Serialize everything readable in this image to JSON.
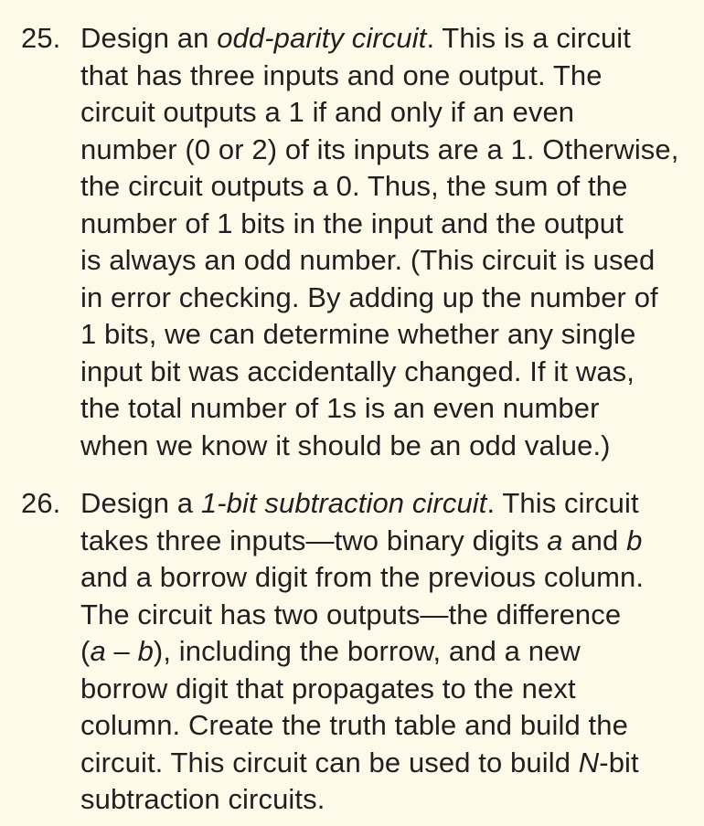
{
  "problems": [
    {
      "number": "25.",
      "lines": [
        [
          {
            "t": "Design an "
          },
          {
            "t": "odd-parity circuit",
            "i": true
          },
          {
            "t": ". This is a circuit"
          }
        ],
        [
          {
            "t": "that has three inputs and one output. The"
          }
        ],
        [
          {
            "t": "circuit outputs a 1 if and only if an even"
          }
        ],
        [
          {
            "t": "number (0 or 2) of its inputs are a 1. Otherwise,"
          }
        ],
        [
          {
            "t": "the circuit outputs a 0. Thus, the sum of the"
          }
        ],
        [
          {
            "t": "number of 1 bits in the input and the output"
          }
        ],
        [
          {
            "t": "is always an odd number. (This circuit is used"
          }
        ],
        [
          {
            "t": "in error checking. By adding up the number of"
          }
        ],
        [
          {
            "t": "1 bits, we can determine whether any single"
          }
        ],
        [
          {
            "t": "input bit was accidentally changed. If it was,"
          }
        ],
        [
          {
            "t": "the total number of 1s is an even number"
          }
        ],
        [
          {
            "t": "when we know it should be an odd value.)"
          }
        ]
      ]
    },
    {
      "number": "26.",
      "lines": [
        [
          {
            "t": "Design a "
          },
          {
            "t": "1-bit subtraction circuit",
            "i": true
          },
          {
            "t": ". This circuit"
          }
        ],
        [
          {
            "t": "takes three inputs—two binary digits "
          },
          {
            "t": "a",
            "i": true
          },
          {
            "t": " and "
          },
          {
            "t": "b",
            "i": true
          }
        ],
        [
          {
            "t": "and a borrow digit from the previous column."
          }
        ],
        [
          {
            "t": "The circuit has two outputs—the difference"
          }
        ],
        [
          {
            "t": "("
          },
          {
            "t": "a",
            "i": true
          },
          {
            "t": " – "
          },
          {
            "t": "b",
            "i": true
          },
          {
            "t": "), including the borrow, and a new"
          }
        ],
        [
          {
            "t": "borrow digit that propagates to the next"
          }
        ],
        [
          {
            "t": "column. Create the truth table and build the"
          }
        ],
        [
          {
            "t": "circuit. This circuit can be used to build "
          },
          {
            "t": "N",
            "i": true
          },
          {
            "t": "-bit"
          }
        ],
        [
          {
            "t": "subtraction circuits."
          }
        ]
      ]
    }
  ]
}
